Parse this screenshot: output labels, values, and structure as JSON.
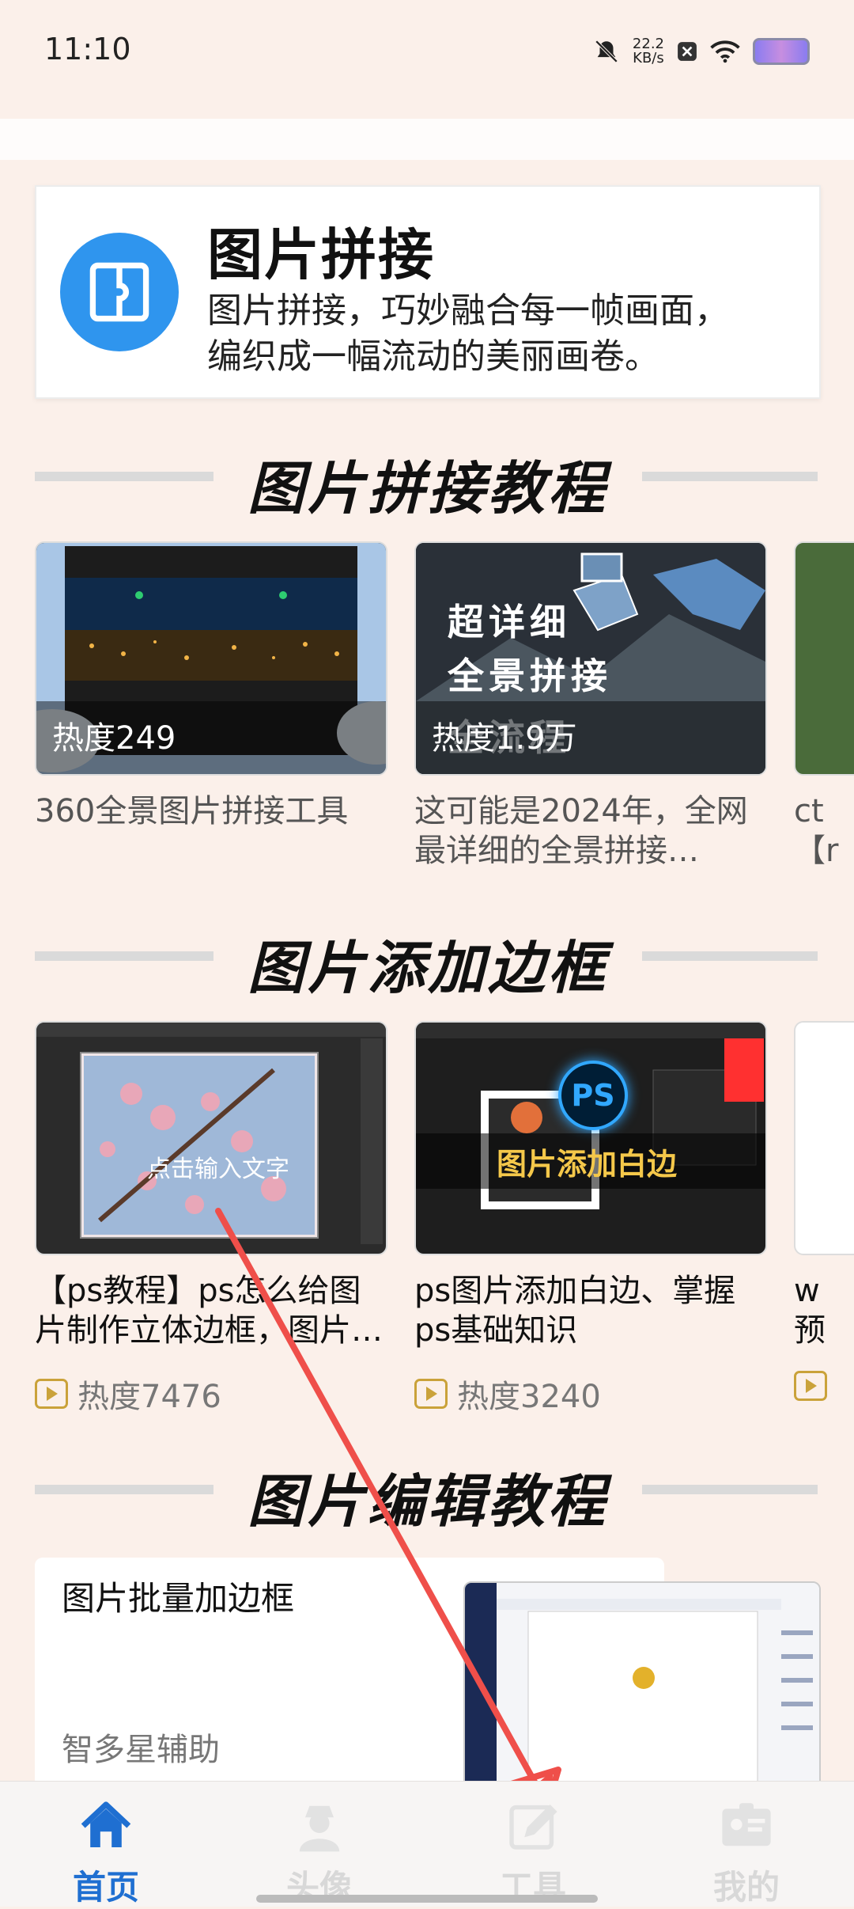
{
  "status": {
    "time": "11:10",
    "speed_value": "22.2",
    "speed_unit": "KB/s"
  },
  "hero": {
    "title": "图片拼接",
    "desc_line1": "图片拼接，巧妙融合每一帧画面，",
    "desc_line2": "编织成一幅流动的美丽画卷。"
  },
  "sections": [
    {
      "title": "图片拼接教程",
      "cards": [
        {
          "heat": "热度249",
          "title": "360全景图片拼接工具"
        },
        {
          "heat": "热度1.9万",
          "title": "这可能是2024年，全网最详细的全景拼接…",
          "thumb_text1": "超详细",
          "thumb_text2": "全景拼接",
          "thumb_text3": "全流程"
        },
        {
          "title": "ct【r"
        }
      ]
    },
    {
      "title": "图片添加边框",
      "cards": [
        {
          "title": "【ps教程】ps怎么给图片制作立体边框，图片…",
          "heat": "热度7476",
          "thumb_text": "点击输入文字"
        },
        {
          "title": "ps图片添加白边、掌握ps基础知识",
          "heat": "热度3240",
          "thumb_text": "图片添加白边",
          "ps_badge": "PS"
        },
        {
          "title": "w预"
        }
      ]
    },
    {
      "title": "图片编辑教程",
      "cards": [
        {
          "title": "图片批量加边框",
          "subtitle": "智多星辅助"
        }
      ]
    }
  ],
  "tabs": [
    {
      "label": "首页",
      "icon": "home-icon",
      "active": true
    },
    {
      "label": "头像",
      "icon": "avatar-icon",
      "active": false
    },
    {
      "label": "工具",
      "icon": "edit-icon",
      "active": false
    },
    {
      "label": "我的",
      "icon": "profile-card-icon",
      "active": false
    }
  ],
  "colors": {
    "accent": "#1f6fd1",
    "hero_icon_bg": "#2f95ee",
    "annotation_arrow": "#ef4f4a"
  }
}
